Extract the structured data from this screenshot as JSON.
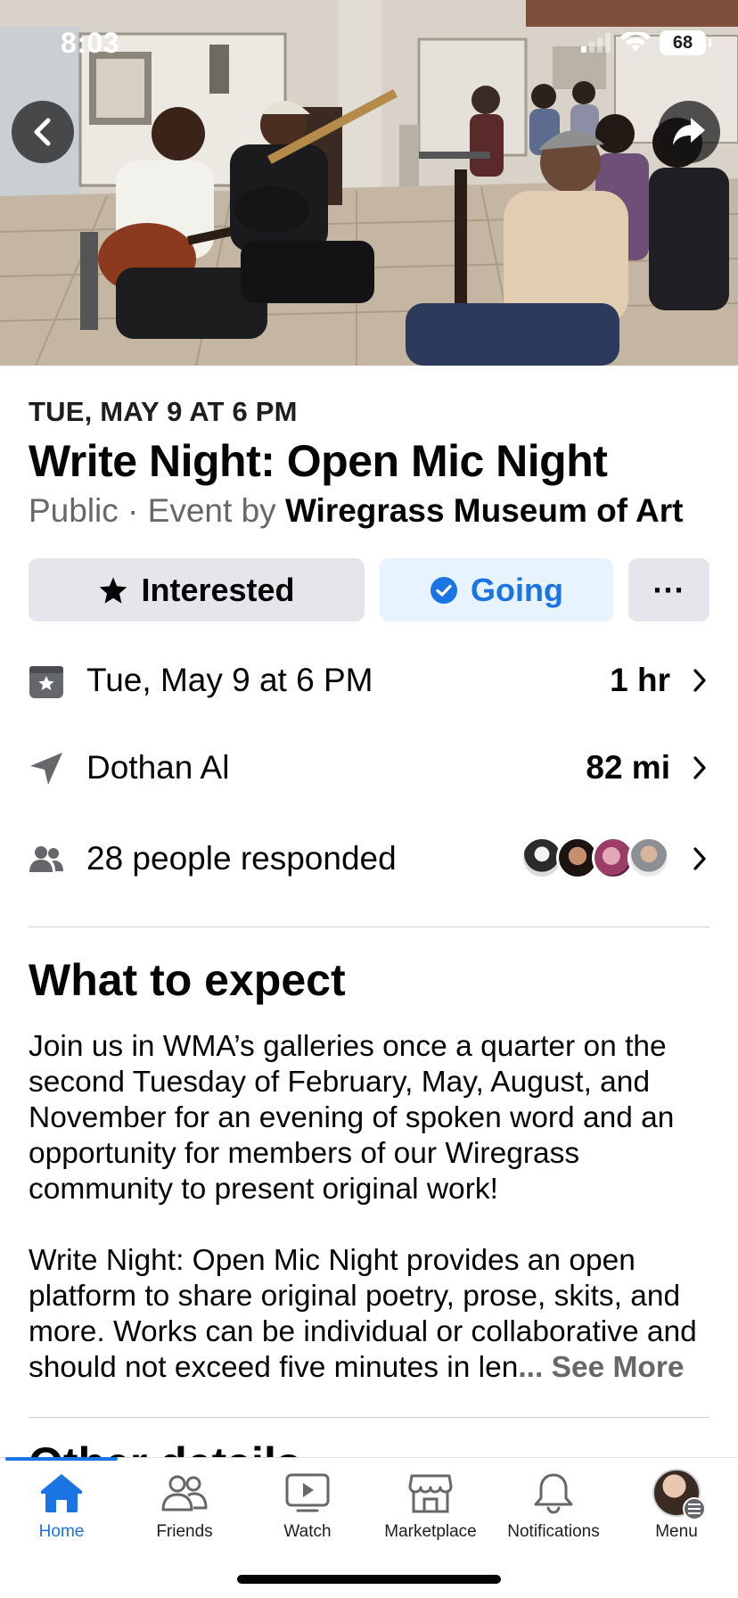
{
  "status_bar": {
    "time": "8:03",
    "battery": "68"
  },
  "event": {
    "date_caps": "TUE, MAY 9 AT 6 PM",
    "title": "Write Night: Open Mic Night",
    "privacy": "Public",
    "separator": " · ",
    "by_prefix": "Event by ",
    "host": "Wiregrass Museum of Art"
  },
  "actions": {
    "interested": "Interested",
    "going": "Going",
    "more": "···"
  },
  "details": {
    "date": {
      "text": "Tue, May 9 at 6 PM",
      "right": "1 hr"
    },
    "location": {
      "text": "Dothan Al",
      "right": "82 mi"
    },
    "people": {
      "text": "28 people responded"
    }
  },
  "about": {
    "title": "What to expect",
    "paragraph_1": "Join us in WMA’s galleries once a quarter on the second Tuesday of February, May, August, and November for an evening of spoken word and an opportunity for members of our Wiregrass community to present original work!",
    "paragraph_2": "Write Night: Open Mic Night provides an open platform to share original poetry, prose, skits, and more. Works can be individual or collaborative and should not exceed five minutes in len",
    "ellipsis": "... ",
    "see_more": "See More"
  },
  "next_section_title": "Other details",
  "tabs": [
    {
      "label": "Home",
      "icon": "home-icon",
      "active": true
    },
    {
      "label": "Friends",
      "icon": "friends-icon",
      "active": false
    },
    {
      "label": "Watch",
      "icon": "watch-icon",
      "active": false
    },
    {
      "label": "Marketplace",
      "icon": "marketplace-icon",
      "active": false
    },
    {
      "label": "Notifications",
      "icon": "bell-icon",
      "active": false
    },
    {
      "label": "Menu",
      "icon": "menu-avatar",
      "active": false
    }
  ],
  "colors": {
    "accent": "#1b74e4",
    "going_bg": "#e7f3ff",
    "button_bg": "#e4e6eb",
    "secondary_text": "#65676b"
  }
}
